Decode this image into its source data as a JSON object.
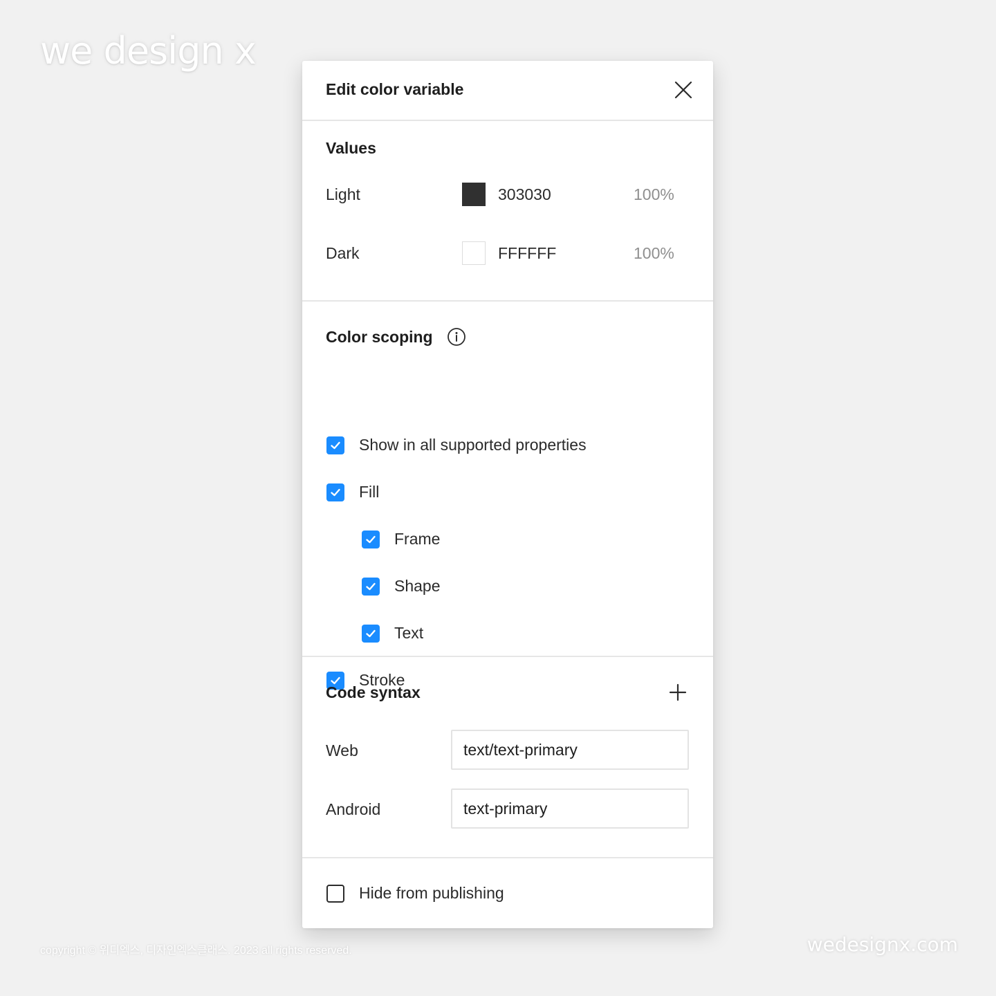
{
  "brand": {
    "logo_text": "we design x",
    "copyright": "copyright © 위디엑스, 디자인엑스클래스. 2023 all rights reserved.",
    "site": "wedesignx.com"
  },
  "dialog": {
    "title": "Edit color variable",
    "close_icon": "close-icon",
    "values": {
      "heading": "Values",
      "rows": [
        {
          "mode": "Light",
          "hex": "303030",
          "swatch_color": "#303030",
          "opacity": "100%"
        },
        {
          "mode": "Dark",
          "hex": "FFFFFF",
          "swatch_color": "#FFFFFF",
          "opacity": "100%"
        }
      ]
    },
    "scoping": {
      "heading": "Color scoping",
      "info_icon": "info-icon",
      "options": [
        {
          "label": "Show in all supported properties",
          "checked": true,
          "indent": 0
        },
        {
          "label": "Fill",
          "checked": true,
          "indent": 0
        },
        {
          "label": "Frame",
          "checked": true,
          "indent": 1
        },
        {
          "label": "Shape",
          "checked": true,
          "indent": 1
        },
        {
          "label": "Text",
          "checked": true,
          "indent": 1
        },
        {
          "label": "Stroke",
          "checked": true,
          "indent": 0
        }
      ]
    },
    "code_syntax": {
      "heading": "Code syntax",
      "add_icon": "plus-icon",
      "rows": [
        {
          "platform": "Web",
          "value": "text/text-primary"
        },
        {
          "platform": "Android",
          "value": "text-primary"
        }
      ]
    },
    "footer": {
      "hide_label": "Hide from publishing",
      "hide_checked": false
    }
  },
  "colors": {
    "accent": "#1a8cff",
    "background": "#f1f1f1",
    "panel": "#ffffff",
    "divider": "#e6e6e6"
  }
}
